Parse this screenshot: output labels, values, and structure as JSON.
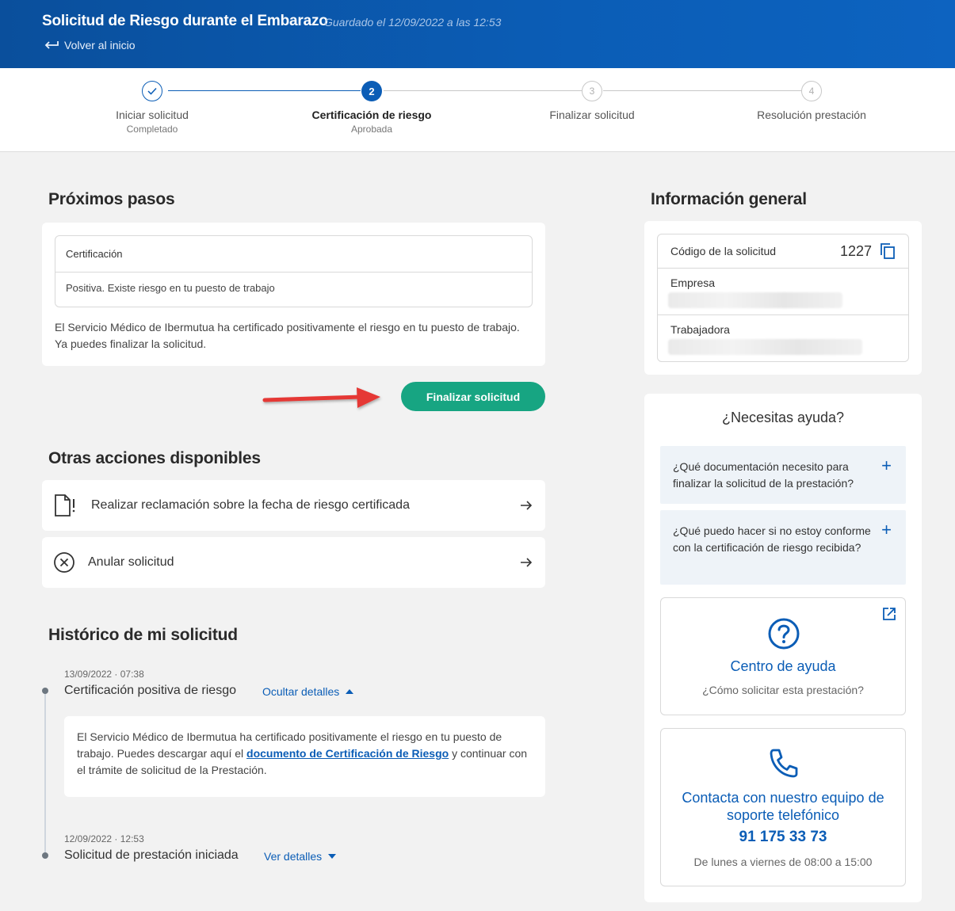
{
  "header": {
    "title": "Solicitud de Riesgo durante el Embarazo",
    "saved": "Guardado el 12/09/2022 a las 12:53",
    "back_label": "Volver al inicio"
  },
  "stepper": {
    "steps": [
      {
        "number": "1",
        "label": "Iniciar solicitud",
        "sub": "Completado",
        "state": "done"
      },
      {
        "number": "2",
        "label": "Certificación de riesgo",
        "sub": "Aprobada",
        "state": "active"
      },
      {
        "number": "3",
        "label": "Finalizar solicitud",
        "sub": "",
        "state": "pending"
      },
      {
        "number": "4",
        "label": "Resolución prestación",
        "sub": "",
        "state": "pending"
      }
    ]
  },
  "next_steps": {
    "title": "Próximos pasos",
    "cert_header": "Certificación",
    "cert_value": "Positiva. Existe riesgo en tu puesto de trabajo",
    "description": "El Servicio Médico de Ibermutua ha certificado positivamente el riesgo en tu puesto de trabajo. Ya puedes finalizar la solicitud.",
    "button_label": "Finalizar solicitud"
  },
  "other_actions": {
    "title": "Otras acciones disponibles",
    "items": [
      {
        "label": "Realizar reclamación sobre la fecha de riesgo certificada",
        "icon": "document-alert-icon"
      },
      {
        "label": "Anular solicitud",
        "icon": "cancel-circle-icon"
      }
    ]
  },
  "history": {
    "title": "Histórico de mi solicitud",
    "items": [
      {
        "date": "13/09/2022 · 07:38",
        "title": "Certificación positiva de riesgo",
        "link": "Ocultar detalles",
        "detail_before": "El Servicio Médico de Ibermutua ha certificado positivamente el riesgo en tu puesto de trabajo. Puedes descargar aquí el ",
        "detail_link": "documento de Certificación de Riesgo",
        "detail_after": " y continuar con el trámite de solicitud de la Prestación."
      },
      {
        "date": "12/09/2022 · 12:53",
        "title": "Solicitud de prestación iniciada",
        "link": "Ver detalles"
      }
    ]
  },
  "general_info": {
    "title": "Información general",
    "code_label": "Código de la solicitud",
    "code_value": "1227",
    "company_label": "Empresa",
    "worker_label": "Trabajadora"
  },
  "help": {
    "title": "¿Necesitas ayuda?",
    "faqs": [
      "¿Qué documentación necesito para finalizar la solicitud de la prestación?",
      "¿Qué puedo hacer si no estoy conforme con la certificación de riesgo recibida?"
    ],
    "help_center_title": "Centro de ayuda",
    "help_center_sub": "¿Cómo solicitar esta prestación?",
    "contact_title": "Contacta con nuestro equipo de soporte telefónico",
    "phone": "91 175 33 73",
    "hours": "De lunes a viernes de 08:00 a 15:00"
  },
  "colors": {
    "primary": "#0b5db6",
    "accent_green": "#17a582",
    "annotation_arrow": "#e53935"
  }
}
